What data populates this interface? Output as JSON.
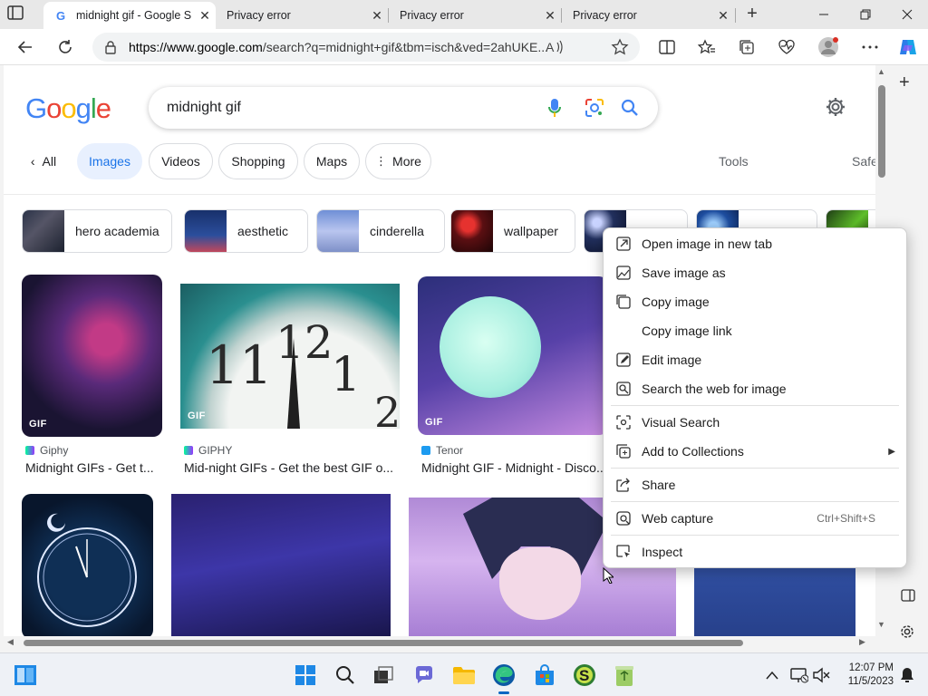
{
  "browser": {
    "tabs": [
      {
        "title": "midnight gif - Google S",
        "active": true
      },
      {
        "title": "Privacy error",
        "active": false
      },
      {
        "title": "Privacy error",
        "active": false
      },
      {
        "title": "Privacy error",
        "active": false
      }
    ],
    "url_host": "https://www.google.com",
    "url_rest": "/search?q=midnight+gif&tbm=isch&ved=2ahUKE..."
  },
  "search": {
    "logo": "Google",
    "query": "midnight gif"
  },
  "filters": {
    "back_label": "All",
    "items": [
      "Images",
      "Videos",
      "Shopping",
      "Maps",
      "More"
    ],
    "tools": "Tools",
    "safe": "Safe"
  },
  "related": [
    "hero academia",
    "aesthetic",
    "cinderella",
    "wallpaper"
  ],
  "results": [
    {
      "badge": "GIF",
      "source": "Giphy",
      "caption": "Midnight GIFs - Get t..."
    },
    {
      "badge": "GIF",
      "source": "GIPHY",
      "caption": "Mid-night GIFs - Get the best GIF o..."
    },
    {
      "badge": "GIF",
      "source": "Tenor",
      "caption": "Midnight GIF - Midnight - Disco..."
    }
  ],
  "context_menu": {
    "open_new_tab": "Open image in new tab",
    "save_as": "Save image as",
    "copy_image": "Copy image",
    "copy_link": "Copy image link",
    "edit": "Edit image",
    "search_web": "Search the web for image",
    "visual_search": "Visual Search",
    "add_collections": "Add to Collections",
    "share": "Share",
    "web_capture": "Web capture",
    "web_capture_shortcut": "Ctrl+Shift+S",
    "inspect": "Inspect"
  },
  "taskbar": {
    "time": "12:07 PM",
    "date": "11/5/2023"
  },
  "colors": {
    "google_blue": "#4285F4",
    "google_red": "#EA4335",
    "google_yellow": "#FBBC05",
    "google_green": "#34A853",
    "chip_active_bg": "#e8f0fe",
    "chip_active_text": "#1a73e8"
  }
}
